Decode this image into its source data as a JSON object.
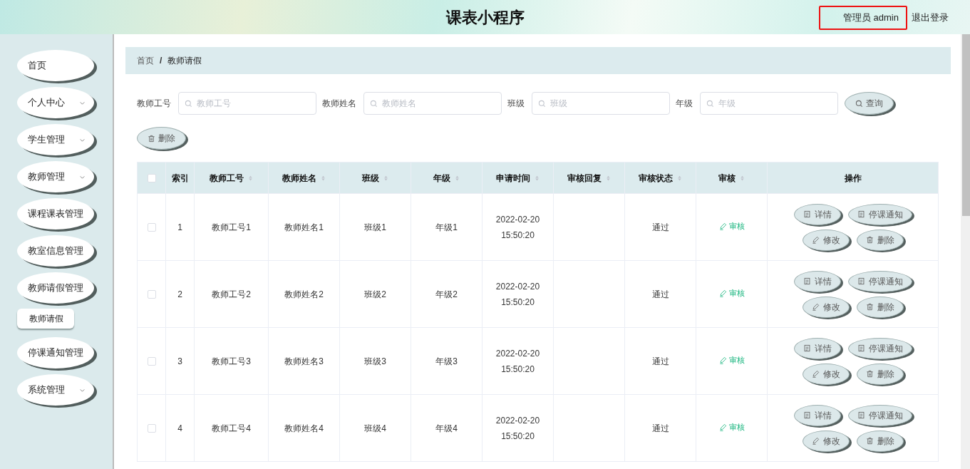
{
  "header": {
    "title": "课表小程序",
    "user": "管理员 admin",
    "logout": "退出登录"
  },
  "sidebar": {
    "items": [
      {
        "label": "首页",
        "has_arrow": false,
        "selected": false
      },
      {
        "label": "个人中心",
        "has_arrow": true,
        "selected": false
      },
      {
        "label": "学生管理",
        "has_arrow": true,
        "selected": false
      },
      {
        "label": "教师管理",
        "has_arrow": true,
        "selected": false
      },
      {
        "label": "课程课表管理",
        "has_arrow": false,
        "selected": false
      },
      {
        "label": "教室信息管理",
        "has_arrow": false,
        "selected": false
      },
      {
        "label": "教师请假管理",
        "has_arrow": false,
        "selected": false,
        "children": [
          {
            "label": "教师请假",
            "selected": true
          }
        ]
      },
      {
        "label": "停课通知管理",
        "has_arrow": false,
        "selected": false
      },
      {
        "label": "系统管理",
        "has_arrow": true,
        "selected": false
      }
    ]
  },
  "breadcrumb": [
    "首页",
    "教师请假"
  ],
  "breadcrumb_separator": "/",
  "filters": [
    {
      "label": "教师工号",
      "placeholder": "教师工号"
    },
    {
      "label": "教师姓名",
      "placeholder": "教师姓名"
    },
    {
      "label": "班级",
      "placeholder": "班级"
    },
    {
      "label": "年级",
      "placeholder": "年级"
    }
  ],
  "search_button": "查询",
  "delete_button": "删除",
  "table": {
    "all_checked": false,
    "columns": [
      {
        "label": "索引",
        "sortable": false
      },
      {
        "label": "教师工号",
        "sortable": true
      },
      {
        "label": "教师姓名",
        "sortable": true
      },
      {
        "label": "班级",
        "sortable": true
      },
      {
        "label": "年级",
        "sortable": true
      },
      {
        "label": "申请时间",
        "sortable": true
      },
      {
        "label": "审核回复",
        "sortable": true
      },
      {
        "label": "审核状态",
        "sortable": true
      },
      {
        "label": "审核",
        "sortable": true
      },
      {
        "label": "操作",
        "sortable": false
      }
    ],
    "rows": [
      {
        "checked": false,
        "cells": [
          "1",
          "教师工号1",
          "教师姓名1",
          "班级1",
          "年级1",
          "2022-02-20 15:50:20",
          "",
          "通过"
        ],
        "review": "审核",
        "actions": [
          "详情",
          "停课通知",
          "修改",
          "删除"
        ]
      },
      {
        "checked": false,
        "cells": [
          "2",
          "教师工号2",
          "教师姓名2",
          "班级2",
          "年级2",
          "2022-02-20 15:50:20",
          "",
          "通过"
        ],
        "review": "审核",
        "actions": [
          "详情",
          "停课通知",
          "修改",
          "删除"
        ]
      },
      {
        "checked": false,
        "cells": [
          "3",
          "教师工号3",
          "教师姓名3",
          "班级3",
          "年级3",
          "2022-02-20 15:50:20",
          "",
          "通过"
        ],
        "review": "审核",
        "actions": [
          "详情",
          "停课通知",
          "修改",
          "删除"
        ]
      },
      {
        "checked": false,
        "cells": [
          "4",
          "教师工号4",
          "教师姓名4",
          "班级4",
          "年级4",
          "2022-02-20 15:50:20",
          "",
          "通过"
        ],
        "review": "审核",
        "actions": [
          "详情",
          "停课通知",
          "修改",
          "删除"
        ]
      }
    ]
  }
}
